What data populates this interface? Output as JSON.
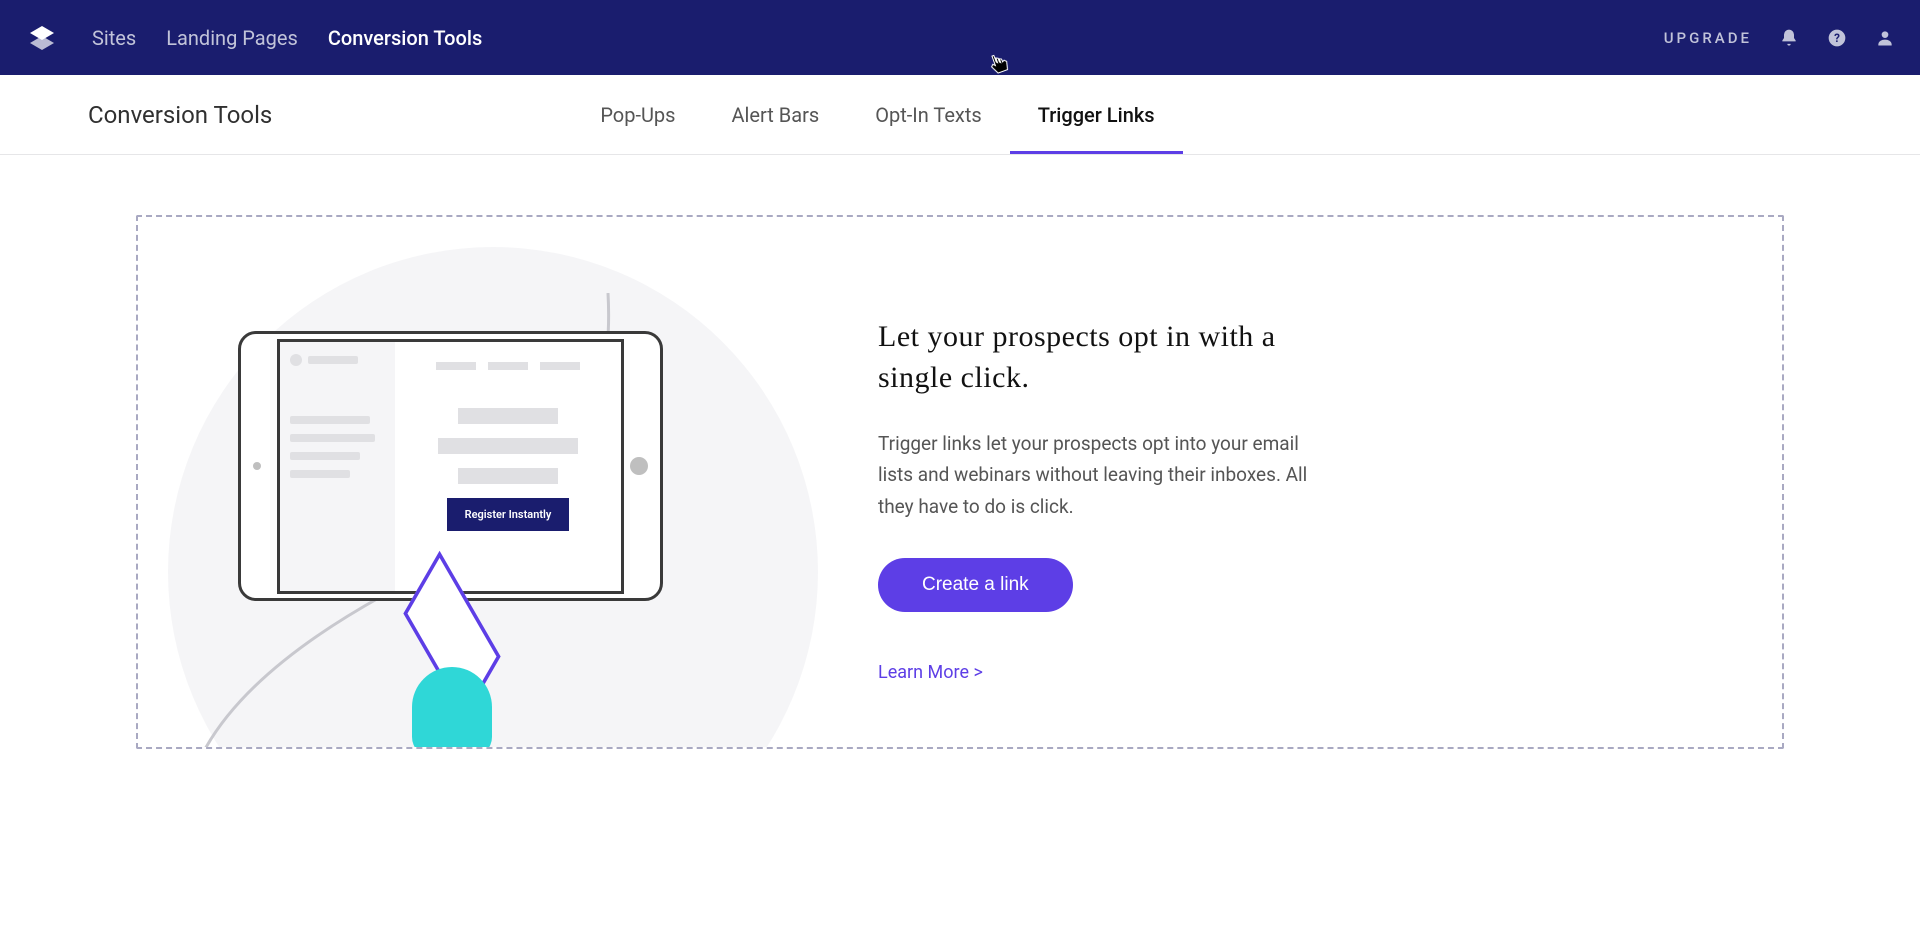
{
  "topnav": {
    "links": [
      "Sites",
      "Landing Pages",
      "Conversion Tools"
    ],
    "active_index": 2,
    "upgrade_label": "UPGRADE"
  },
  "subnav": {
    "title": "Conversion Tools",
    "tabs": [
      "Pop-Ups",
      "Alert Bars",
      "Opt-In Texts",
      "Trigger Links"
    ],
    "active_index": 3
  },
  "panel": {
    "headline": "Let your prospects opt in with a single click.",
    "description": "Trigger links let your prospects opt into your email lists and webinars without leaving their inboxes. All they have to do is click.",
    "cta_label": "Create a link",
    "learn_more_label": "Learn More >",
    "illustration_cta": "Register Instantly"
  },
  "colors": {
    "navy": "#1a1d6e",
    "purple": "#5d3ee6",
    "teal": "#2fd7d7"
  }
}
